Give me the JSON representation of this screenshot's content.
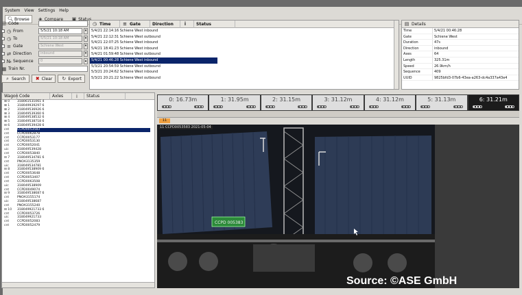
{
  "menu": [
    "System",
    "View",
    "Settings",
    "Help"
  ],
  "toolbar": {
    "tabs": [
      "Browse",
      "Compare",
      "Status"
    ]
  },
  "search": {
    "fields": [
      {
        "label": "Code",
        "value": "",
        "checkbox": false
      },
      {
        "label": "From",
        "value": "5/5/21 10:18 AM",
        "checkbox": true
      },
      {
        "label": "To",
        "value": "5/5/21 10:18 AM",
        "checkbox": true
      },
      {
        "label": "Gate",
        "value": "Schiene West",
        "checkbox": true
      },
      {
        "label": "Direction",
        "value": "inbound",
        "checkbox": true
      },
      {
        "label": "Sequence",
        "value": "0",
        "checkbox": true
      },
      {
        "label": "Train Nr.",
        "value": "",
        "checkbox": false
      }
    ],
    "buttons": [
      "Search",
      "Clear",
      "Export"
    ]
  },
  "results": {
    "headers": [
      "Time",
      "Gate",
      "Direction",
      "Status"
    ],
    "rows": [
      "5/4/21 22:14:16 Schiene West  inbound",
      "5/4/21 22:12:31 Schiene West  outbound",
      "5/4/21 22:07:25 Schiene West  inbound",
      "5/4/21 18:41:23 Schiene West  inbound",
      "5/4/21 01:59:48 Schiene West  outbound",
      "5/4/21 00:46:28 Schiene West  inbound",
      "5/3/21 20:54:59 Schiene West  outbound",
      "5/3/21 20:24:62 Schiene West  inbound",
      "5/3/21 20:21:22 Schiene West  outbound"
    ],
    "selected_index": 5
  },
  "details": {
    "title": "Details",
    "rows": [
      {
        "k": "Time",
        "v": "5/4/21 00:46:28"
      },
      {
        "k": "Gate",
        "v": "Schiene West"
      },
      {
        "k": "Duration",
        "v": "47s"
      },
      {
        "k": "Direction",
        "v": "inbound"
      },
      {
        "k": "Axes",
        "v": "64"
      },
      {
        "k": "Length",
        "v": "325.31m"
      },
      {
        "k": "Speed",
        "v": "26.9km/h"
      },
      {
        "k": "Sequence",
        "v": "409"
      },
      {
        "k": "UUID",
        "v": "9825bfd3-07b6-43ea-a263-dc4a337a43e4"
      }
    ]
  },
  "tree": {
    "headers": [
      "Wagon",
      "Code",
      "Axles",
      "Status"
    ],
    "rows": [
      {
        "c1": "⊞ 0",
        "c2": "318061531061  4"
      },
      {
        "c1": "⊞ 1",
        "c2": "318049939297  6"
      },
      {
        "c1": "⊞ 2",
        "c2": "318049536926  6"
      },
      {
        "c1": "⊞ 3",
        "c2": "318049539360  6"
      },
      {
        "c1": "⊞ 4",
        "c2": "318049538532  6"
      },
      {
        "c1": "⊞ 5",
        "c2": "318049538718  6"
      },
      {
        "c1": "⊟ 6",
        "c2": "318049539428  6"
      },
      {
        "c1": "  cnt",
        "c2": "CCPD0053583",
        "sel": true
      },
      {
        "c1": "  cnt",
        "c2": "CCPD0062878"
      },
      {
        "c1": "  cnt",
        "c2": "CCPD0053177"
      },
      {
        "c1": "  cnt",
        "c2": "CCPD0053130"
      },
      {
        "c1": "  cnt",
        "c2": "CCPD0052041"
      },
      {
        "c1": "  uic",
        "c2": "318049539428"
      },
      {
        "c1": "  cnt",
        "c2": "CCPD0053840"
      },
      {
        "c1": "⊟ 7",
        "c2": "318049534781  6"
      },
      {
        "c1": "  cnt",
        "c2": "PNOA3135359"
      },
      {
        "c1": "  uic",
        "c2": "318049534781"
      },
      {
        "c1": "⊟ 8",
        "c2": "318049538909  6"
      },
      {
        "c1": "  cnt",
        "c2": "CCPD0053648"
      },
      {
        "c1": "  cnt",
        "c2": "CCPD0053407"
      },
      {
        "c1": "  cnt",
        "c2": "CCPD0063508"
      },
      {
        "c1": "  uic",
        "c2": "318049538909"
      },
      {
        "c1": "  cnt",
        "c2": "CCPD0049074"
      },
      {
        "c1": "⊟ 9",
        "c2": "318049538687  6"
      },
      {
        "c1": "  cnt",
        "c2": "PNOA3155174"
      },
      {
        "c1": "  uic",
        "c2": "318049538687"
      },
      {
        "c1": "  cnt",
        "c2": "PNOA3155240"
      },
      {
        "c1": "⊟ 10",
        "c2": "318049921733  6"
      },
      {
        "c1": "  cnt",
        "c2": "CCPD0053726"
      },
      {
        "c1": "  uic",
        "c2": "318049921733"
      },
      {
        "c1": "  cnt",
        "c2": "CCPD0052083"
      },
      {
        "c1": "  cnt",
        "c2": "CCPD0052479"
      }
    ]
  },
  "axles": [
    "0: 16.73m",
    "1: 31.95m",
    "2: 31.15m",
    "3: 31.12m",
    "4: 31.12m",
    "5: 31.13m",
    "6: 31.21m"
  ],
  "marker": "11",
  "camera": {
    "overlay": "11 CCPD0053583 2021-05-04",
    "plate": "CCPD 005383"
  },
  "watermark": "Source: ©ASE GmbH"
}
